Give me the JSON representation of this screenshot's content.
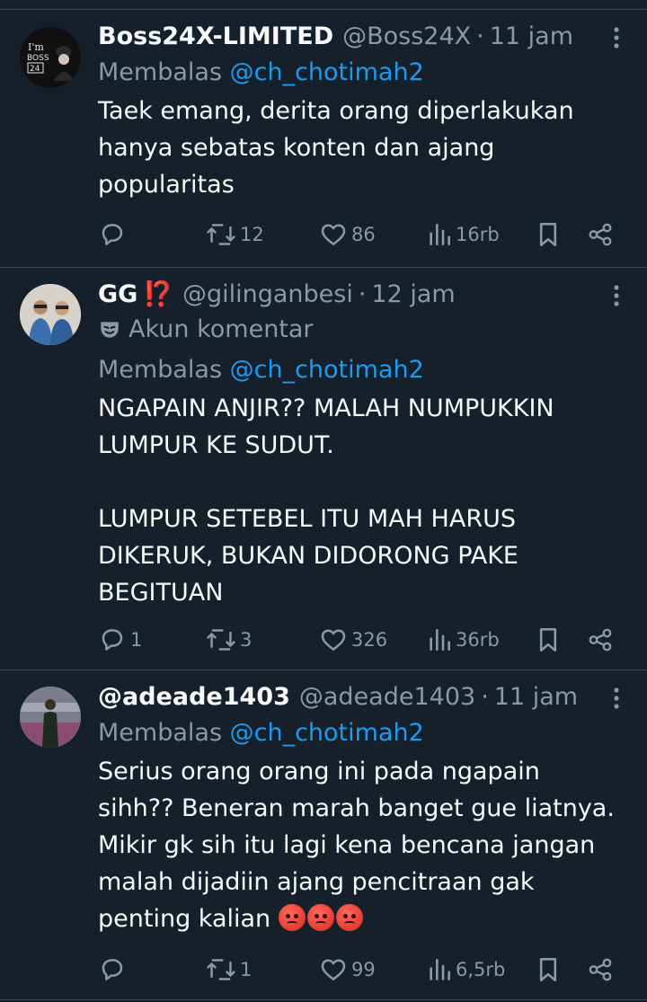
{
  "tweets": [
    {
      "display_name": "Boss24X-LIMITED",
      "handle": "@Boss24X",
      "time": "11 jam",
      "reply_prefix": "Membalas",
      "reply_to": "@ch_chotimah2",
      "body": "Taek emang, derita orang diperlakukan\nhanya sebatas konten dan ajang\npopularitas",
      "avatar_text": [
        "I'm",
        "BOSS",
        "24"
      ],
      "stats": {
        "replies": "",
        "reposts": "12",
        "likes": "86",
        "views": "16rb"
      }
    },
    {
      "display_name": "GG",
      "name_emoji": "⁉️",
      "handle": "@gilinganbesi",
      "time": "12 jam",
      "label": "Akun komentar",
      "reply_prefix": "Membalas",
      "reply_to": "@ch_chotimah2",
      "body": "NGAPAIN ANJIR?? MALAH NUMPUKKIN\nLUMPUR KE SUDUT.\n\nLUMPUR SETEBEL ITU MAH HARUS\nDIKERUK, BUKAN DIDORONG PAKE\nBEGITUAN",
      "stats": {
        "replies": "1",
        "reposts": "3",
        "likes": "326",
        "views": "36rb"
      }
    },
    {
      "display_name": "@adeade1403",
      "handle": "@adeade1403",
      "time": "11 jam",
      "reply_prefix": "Membalas",
      "reply_to": "@ch_chotimah2",
      "body": "Serius orang orang ini pada ngapain\nsihh?? Beneran marah banget gue liatnya.\nMikir gk sih itu lagi kena bencana jangan\nmalah dijadiin ajang pencitraan gak\npenting kalian ",
      "stats": {
        "replies": "",
        "reposts": "1",
        "likes": "99",
        "views": "6,5rb"
      }
    }
  ],
  "separator": "·",
  "icons": [
    "reply-icon",
    "repost-icon",
    "like-icon",
    "views-icon",
    "bookmark-icon",
    "share-icon",
    "more-icon",
    "mask-icon",
    "angry-face-emoji"
  ],
  "colors": {
    "background": "#15202b",
    "text": "#f7f9f9",
    "muted": "#8b98a5",
    "link": "#1d9bf0",
    "divider": "#38444d"
  }
}
